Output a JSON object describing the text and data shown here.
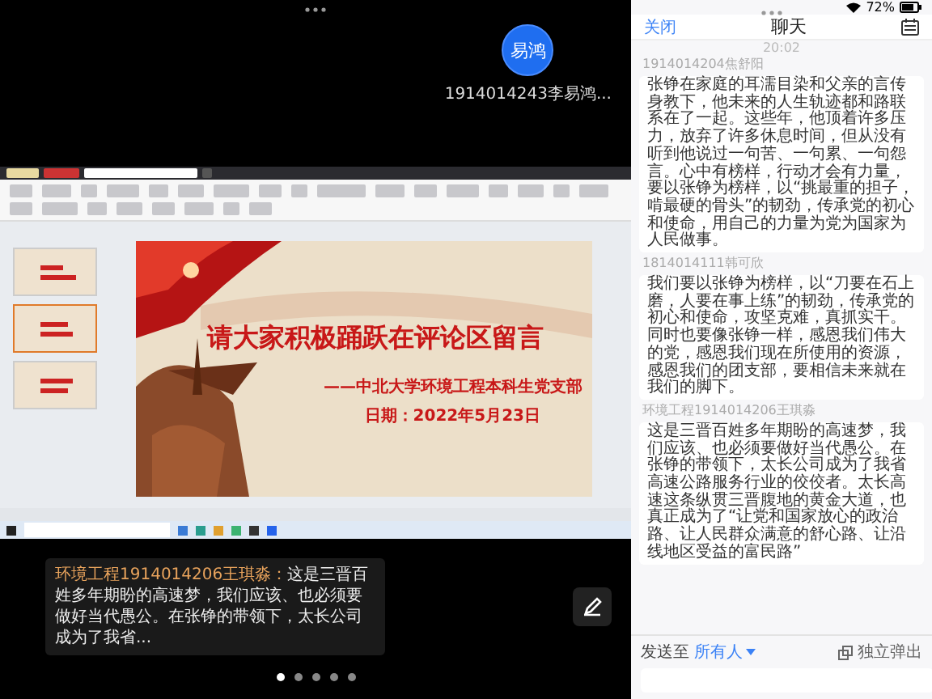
{
  "status_bar": {
    "battery": "72%"
  },
  "meeting": {
    "participant": {
      "avatar_text": "易鸿",
      "name": "1914014243李易鸿..."
    },
    "shared_screen": {
      "slides": [
        {
          "selected": false
        },
        {
          "selected": true
        },
        {
          "selected": false
        }
      ],
      "slide": {
        "title": "请大家积极踊跃在评论区留言",
        "subtitle": "——中北大学环境工程本科生党支部",
        "date": "日期：2022年5月23日"
      }
    },
    "toast": {
      "sender": "环境工程1914014206王琪淼：",
      "text": "这是三晋百姓多年期盼的高速梦，我们应该、也必须要做好当代愚公。在张铮的带领下，太长公司成为了我省..."
    },
    "pages": [
      {
        "selected": true
      },
      {
        "selected": false
      },
      {
        "selected": false
      },
      {
        "selected": false
      },
      {
        "selected": false
      }
    ]
  },
  "chat": {
    "close": "关闭",
    "title": "聊天",
    "time": "20:02",
    "messages": [
      {
        "sender": "1914014204焦舒阳",
        "text": "张铮在家庭的耳濡目染和父亲的言传身教下，他未来的人生轨迹都和路联系在了一起。这些年，他顶着许多压力，放弃了许多休息时间，但从没有听到他说过一句苦、一句累、一句怨言。心中有榜样，行动才会有力量，要以张铮为榜样，以“挑最重的担子，啃最硬的骨头”的韧劲，传承党的初心和使命，用自己的力量为党为国家为人民做事。"
      },
      {
        "sender": "1814014111韩可欣",
        "text": "我们要以张铮为榜样，以“刀要在石上磨，人要在事上练”的韧劲，传承党的初心和使命，攻坚克难，真抓实干。同时也要像张铮一样，感恩我们伟大的党，感恩我们现在所使用的资源，感恩我们的团支部，要相信未来就在我们的脚下。"
      },
      {
        "sender": "环境工程1914014206王琪淼",
        "text": "这是三晋百姓多年期盼的高速梦，我们应该、也必须要做好当代愚公。在张铮的带领下，太长公司成为了我省高速公路服务行业的佼佼者。太长高速这条纵贯三晋腹地的黄金大道，也真正成为了“让党和国家放心的政治路、让人民群众满意的舒心路、让沿线地区受益的富民路”"
      }
    ],
    "send_to_label": "发送至",
    "recipient": "所有人",
    "popout": "独立弹出"
  }
}
